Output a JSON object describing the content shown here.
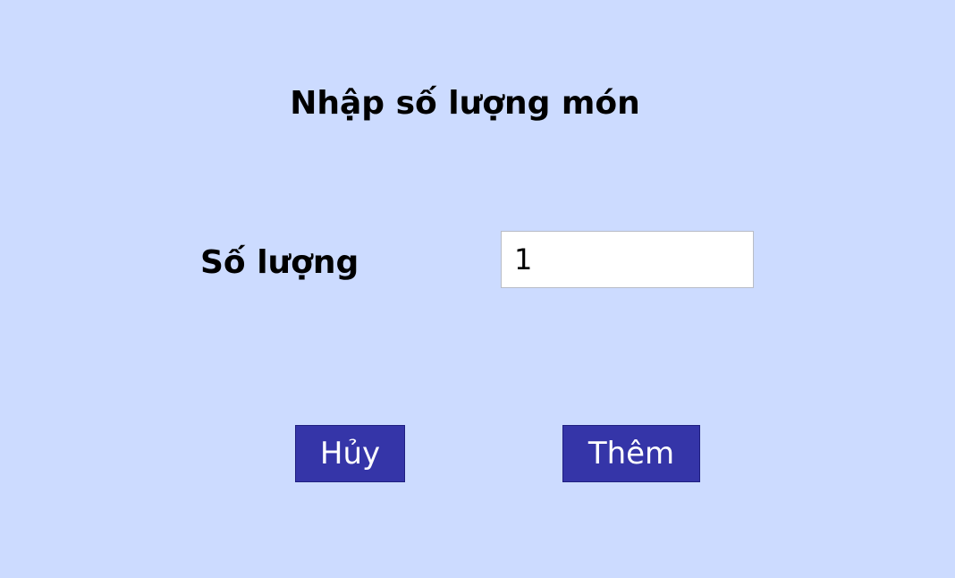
{
  "dialog": {
    "title": "Nhập số lượng món",
    "quantity_label": "Số lượng",
    "quantity_value": "1",
    "cancel_label": "Hủy",
    "add_label": "Thêm"
  },
  "colors": {
    "background": "#ccdbff",
    "button": "#3535a8",
    "button_text": "#ffffff",
    "input_background": "#ffffff"
  }
}
